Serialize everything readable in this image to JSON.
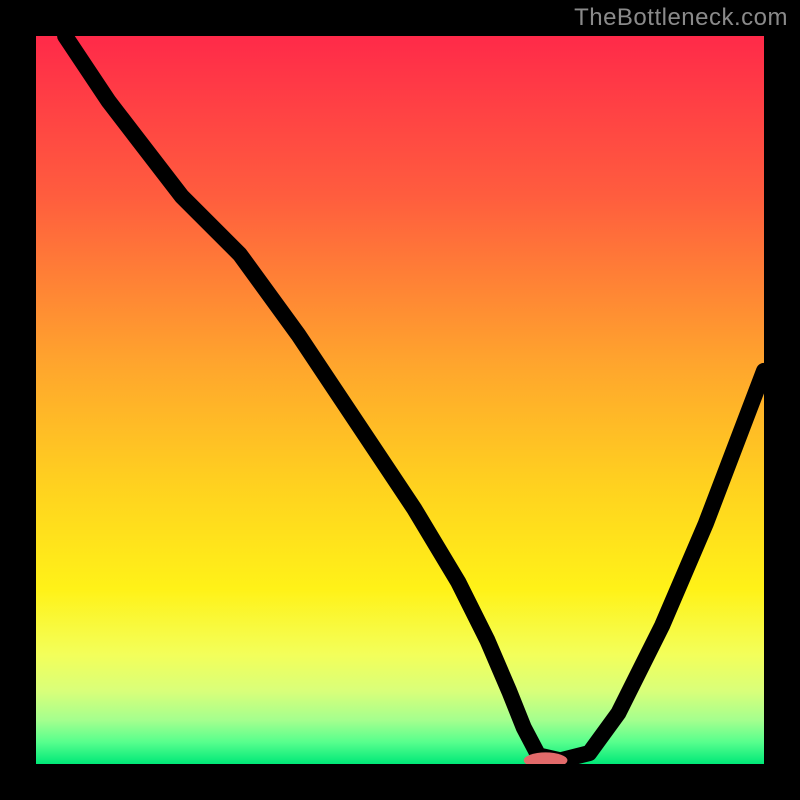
{
  "watermark": {
    "text": "TheBottleneck.com"
  },
  "chart_data": {
    "type": "line",
    "title": "",
    "xlabel": "",
    "ylabel": "",
    "xlim": [
      0,
      100
    ],
    "ylim": [
      0,
      100
    ],
    "series": [
      {
        "name": "curve",
        "x": [
          4,
          10,
          20,
          28,
          36,
          44,
          52,
          58,
          62,
          65,
          67,
          69,
          72,
          76,
          80,
          86,
          92,
          100
        ],
        "y": [
          100,
          91,
          78,
          70,
          59,
          47,
          35,
          25,
          17,
          10,
          5,
          1.2,
          0.5,
          1.5,
          7,
          19,
          33,
          54
        ]
      }
    ],
    "marker": {
      "x": 70,
      "y": 0.5,
      "rx": 3.0,
      "ry": 1.1,
      "color": "#e26a6a"
    },
    "gradient_stops": [
      {
        "offset": 0,
        "color": "#ff2a49"
      },
      {
        "offset": 22,
        "color": "#ff5d3e"
      },
      {
        "offset": 45,
        "color": "#ffa52d"
      },
      {
        "offset": 62,
        "color": "#ffd21f"
      },
      {
        "offset": 76,
        "color": "#fff218"
      },
      {
        "offset": 85,
        "color": "#f3ff5a"
      },
      {
        "offset": 90,
        "color": "#d9ff7a"
      },
      {
        "offset": 94,
        "color": "#a4ff8e"
      },
      {
        "offset": 97,
        "color": "#57ff8d"
      },
      {
        "offset": 100,
        "color": "#00e878"
      }
    ]
  }
}
